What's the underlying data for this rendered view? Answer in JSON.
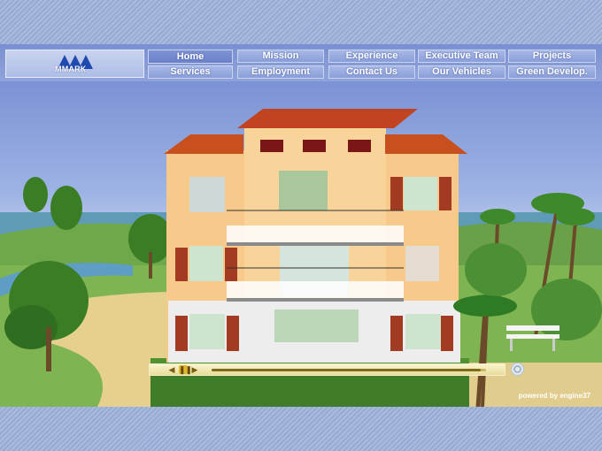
{
  "logo": {
    "text": "MMARK"
  },
  "nav": {
    "row1": [
      "Home",
      "Mission",
      "Experience",
      "Executive Team",
      "Projects"
    ],
    "row2": [
      "Services",
      "Employment",
      "Contact Us",
      "Our Vehicles",
      "Green Develop."
    ],
    "active": "Home"
  },
  "player": {
    "progress": 0.98
  },
  "footer": {
    "powered_by": "powered by engine37"
  },
  "colors": {
    "nav_bg": "#7a8fd0",
    "button": "#a8b8e6",
    "wall": "#f7c98a",
    "roof": "#c2431f"
  }
}
